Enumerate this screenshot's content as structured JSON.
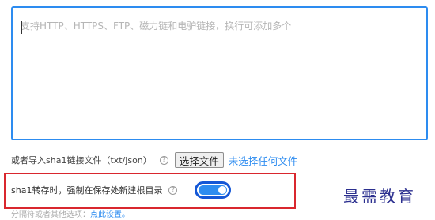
{
  "url_input": {
    "placeholder": "支持HTTP、HTTPS、FTP、磁力链和电驴链接，换行可添加多个",
    "value": ""
  },
  "import": {
    "label": "或者导入sha1链接文件（txt/json）",
    "help_icon": "question-circle-icon",
    "choose_button": "选择文件",
    "file_status": "未选择任何文件"
  },
  "sha1_option": {
    "label": "sha1转存时，强制在保存处新建根目录",
    "help_icon": "question-circle-icon",
    "toggle_on": true
  },
  "hint": {
    "text": "分隔符或者其他选项：",
    "link": "点此设置。"
  },
  "watermark": "最需教育",
  "colors": {
    "accent": "#2d8cf0",
    "toggle_border": "#1457d6",
    "highlight": "#d9272e",
    "watermark": "#2b2f8f"
  }
}
